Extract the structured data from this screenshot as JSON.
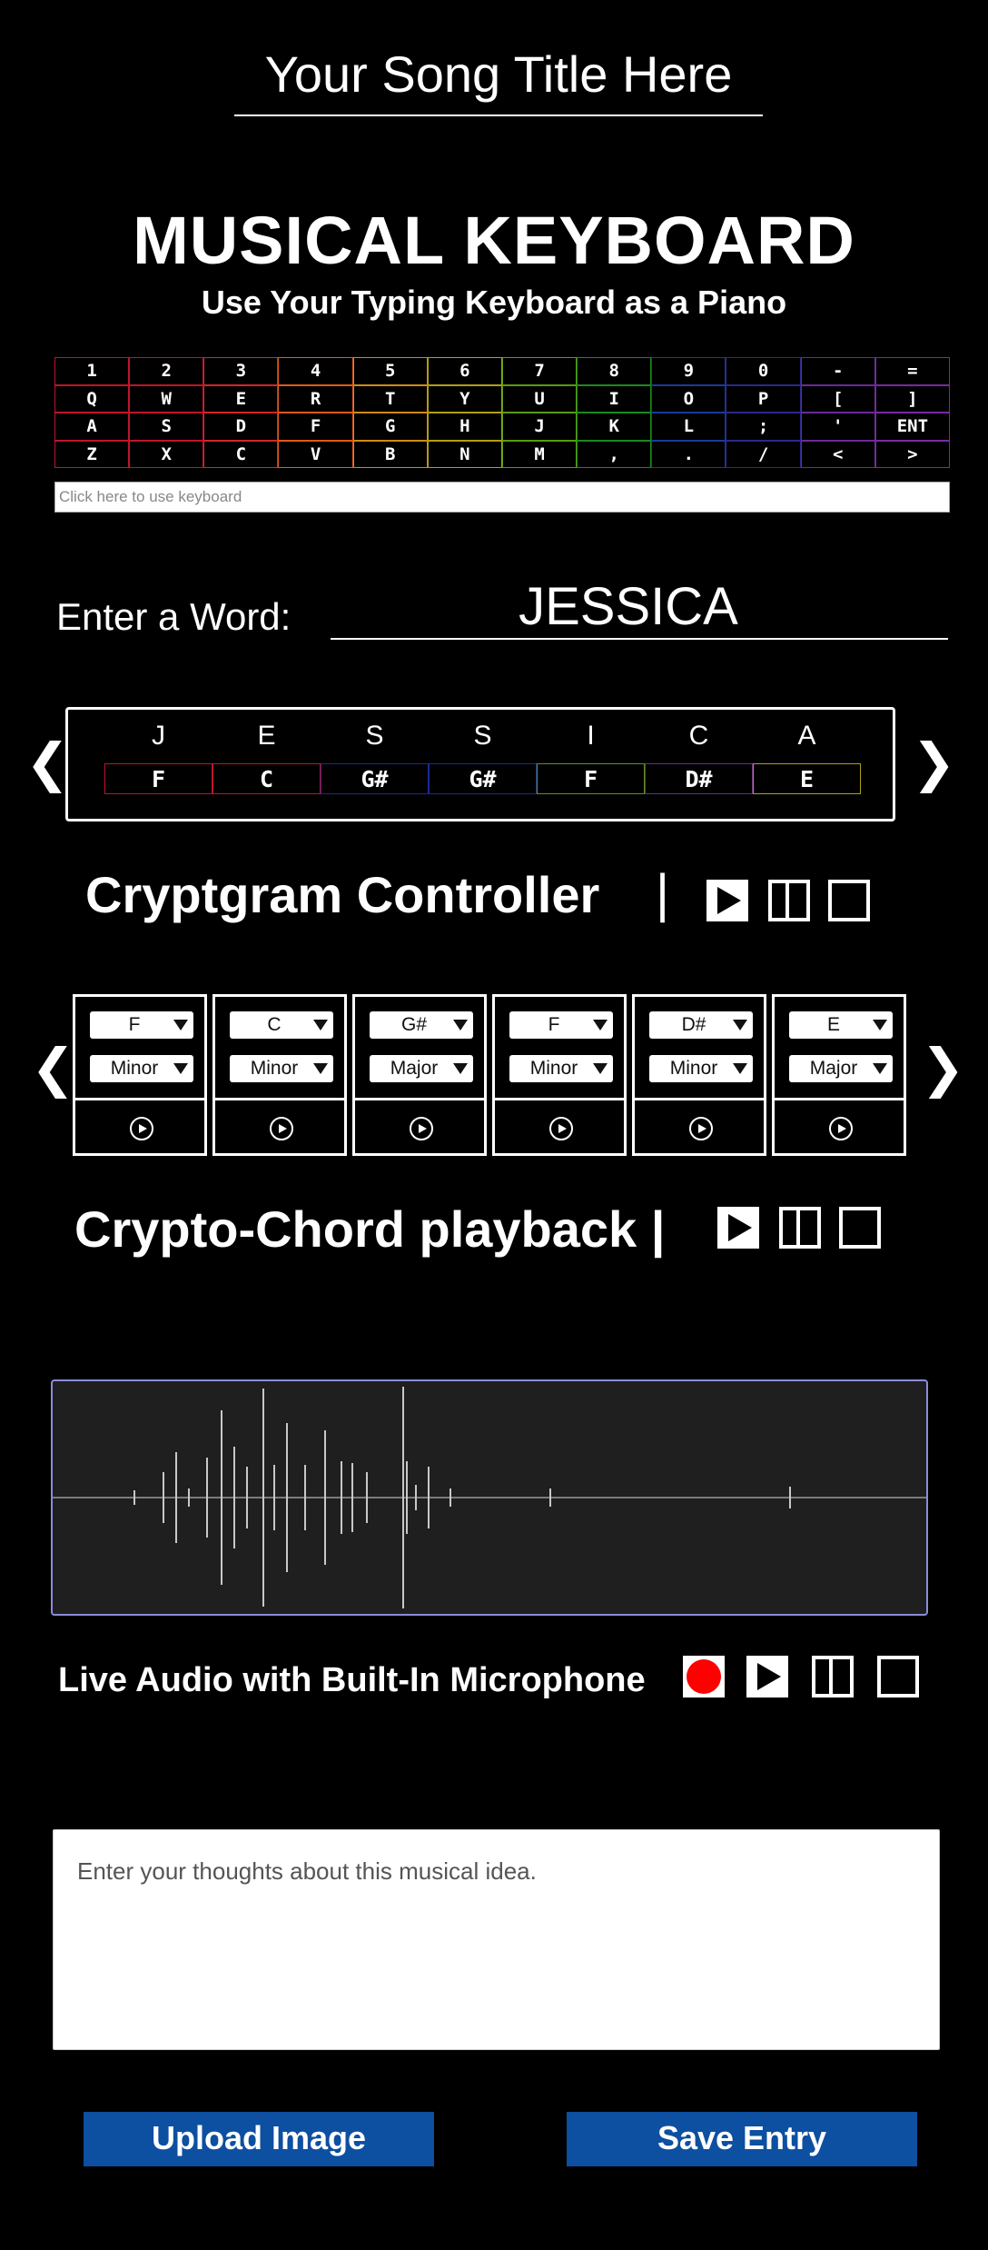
{
  "song": {
    "title": "Your Song Title Here"
  },
  "header": {
    "title": "MUSICAL KEYBOARD",
    "subtitle": "Use Your Typing Keyboard as a Piano"
  },
  "keyboard": {
    "rows": [
      [
        "1",
        "2",
        "3",
        "4",
        "5",
        "6",
        "7",
        "8",
        "9",
        "0",
        "-",
        "="
      ],
      [
        "Q",
        "W",
        "E",
        "R",
        "T",
        "Y",
        "U",
        "I",
        "O",
        "P",
        "[",
        "]"
      ],
      [
        "A",
        "S",
        "D",
        "F",
        "G",
        "H",
        "J",
        "K",
        "L",
        ";",
        "'",
        "ENT"
      ],
      [
        "Z",
        "X",
        "C",
        "V",
        "B",
        "N",
        "M",
        ",",
        ".",
        "/",
        "<",
        ">"
      ]
    ],
    "column_colors": [
      "#c0142a",
      "#c0142a",
      "#d4252a",
      "#e05a18",
      "#d08a10",
      "#b0a010",
      "#5a9a10",
      "#1a8a20",
      "#1a3a9a",
      "#2a2a8a",
      "#6a2a9a",
      "#7a2aa0"
    ],
    "input_placeholder": "Click here to use keyboard"
  },
  "word": {
    "label": "Enter a Word:",
    "value": "JESSICA",
    "letters": [
      "J",
      "E",
      "S",
      "S",
      "I",
      "C",
      "A"
    ],
    "notes": [
      "F",
      "C",
      "G#",
      "G#",
      "F",
      "D#",
      "E"
    ],
    "note_colors": [
      "#c0142a",
      "#c0142a",
      "#1a2a9a",
      "#1a2a9a",
      "#5a9a10",
      "#6a2a9a",
      "#b0a010"
    ],
    "prev_arrow": "❮",
    "next_arrow": "❯"
  },
  "cryptogram": {
    "title": "Cryptgram Controller",
    "separator": "|"
  },
  "chords": {
    "items": [
      {
        "note": "F",
        "quality": "Minor"
      },
      {
        "note": "C",
        "quality": "Minor"
      },
      {
        "note": "G#",
        "quality": "Major"
      },
      {
        "note": "F",
        "quality": "Minor"
      },
      {
        "note": "D#",
        "quality": "Minor"
      },
      {
        "note": "E",
        "quality": "Major"
      }
    ],
    "prev_arrow": "❮",
    "next_arrow": "❯"
  },
  "playback": {
    "title": "Crypto-Chord playback |"
  },
  "live_audio": {
    "title": "Live Audio with Built-In Microphone"
  },
  "notes_area": {
    "placeholder": "Enter your thoughts about this musical idea."
  },
  "actions": {
    "upload_label": "Upload Image",
    "save_label": "Save Entry"
  },
  "icons": {
    "play": "play-icon",
    "pause": "pause-icon",
    "stop": "stop-icon",
    "record": "record-icon"
  },
  "colors": {
    "accent_button": "#0d4fa0",
    "waveform_border": "#8a8cd9",
    "record_red": "#ff0000"
  }
}
